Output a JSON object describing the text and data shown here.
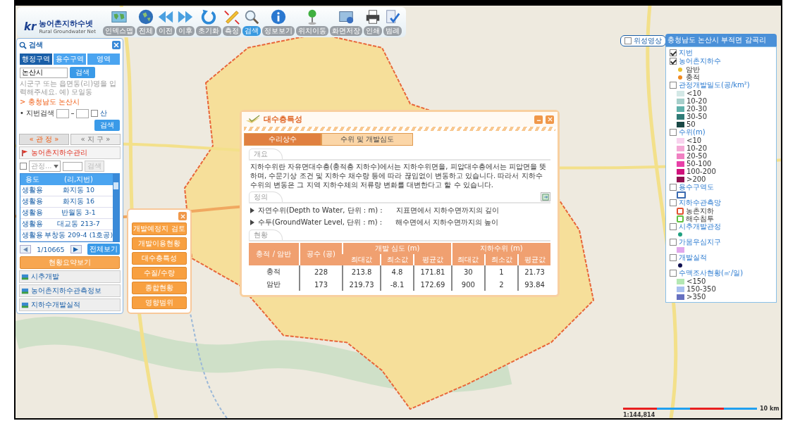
{
  "toolbar": {
    "logo": {
      "mark": "kr",
      "title": "농어촌지하수넷",
      "subtitle": "Rural Groundwater Net"
    },
    "tools": [
      {
        "kind": "index-map",
        "label": "인덱스맵",
        "selected": false
      },
      {
        "kind": "globe",
        "label": "전체",
        "selected": false
      },
      {
        "kind": "back",
        "label": "이전",
        "selected": false
      },
      {
        "kind": "forward",
        "label": "이후",
        "selected": false
      },
      {
        "kind": "reset",
        "label": "초기화",
        "selected": false
      },
      {
        "kind": "measure",
        "label": "측정",
        "selected": false
      },
      {
        "kind": "search",
        "label": "검색",
        "selected": true
      },
      {
        "kind": "info",
        "label": "정보보기",
        "selected": false
      },
      {
        "kind": "pin",
        "label": "위치이동",
        "selected": false
      },
      {
        "kind": "screen",
        "label": "화면저장",
        "selected": false
      },
      {
        "kind": "print",
        "label": "인쇄",
        "selected": false
      },
      {
        "kind": "legend",
        "label": "범례",
        "selected": false
      }
    ]
  },
  "search_panel": {
    "title": "검색",
    "tabs": [
      {
        "label": "행정구역",
        "selected": true
      },
      {
        "label": "용수구역",
        "selected": false
      },
      {
        "label": "영역",
        "selected": false
      }
    ],
    "region_field": {
      "value": "논산시"
    },
    "search_button": "검색",
    "hint": "시군구 또는 읍면동(리)명을 입력해주세요. 예) 모일동",
    "location": "> 충청남도 논산시",
    "lot_search": {
      "label": "• 지번검색",
      "mountain_checked": false,
      "mountain_label": "산",
      "button": "검색"
    },
    "subtabs": [
      {
        "label": "« 관 정 »",
        "selected": true
      },
      {
        "label": "« 지 구 »",
        "selected": false
      }
    ],
    "section": "농어촌지하수관리",
    "filter": {
      "checked": false,
      "select_placeholder": "관정...",
      "button": "검색"
    },
    "table": {
      "columns": [
        "용도",
        "(리,지번)"
      ],
      "rows": [
        [
          "생활용",
          "화지동 10"
        ],
        [
          "생활용",
          "화지동 16"
        ],
        [
          "생활용",
          "반월동 3-1"
        ],
        [
          "생활용",
          "대교동 213-7"
        ],
        [
          "생활용",
          "부창동 209-4 (1호공)"
        ]
      ]
    },
    "pager": {
      "page": "1/10665",
      "all_button": "전체보기"
    },
    "summary_button": "현황요약보기",
    "groups": [
      "시추개발",
      "농어촌지하수관측정보",
      "지하수개발실적"
    ]
  },
  "analysis_menu": {
    "items": [
      "개발예정지 검토",
      "개발이용현황",
      "대수층특성",
      "수질/수량",
      "종합현황",
      "영향범위"
    ]
  },
  "dialog": {
    "title": "대수층특성",
    "tabs": [
      {
        "label": "수리상수",
        "selected": true
      },
      {
        "label": "수위 및 개발심도",
        "selected": false
      }
    ],
    "overview": {
      "heading": "개요",
      "text": "지하수위란 자유면대수층(충적층 지하수)에서는 지하수위면을, 피압대수층에서는 피압면을 뜻하며, 수문기상 조건 및 지하수 채수량 등에 따라 끊임없이 변동하고 있습니다. 따라서 지하수 수위의 변동은 그 지역 지하수체의 저류량 변화를 대변한다고 할 수 있습니다."
    },
    "definitions": {
      "heading": "정의",
      "items": [
        {
          "term": "자연수위(Depth to Water, 단위 : m) :",
          "meaning": "지표면에서 지하수면까지의 깊이"
        },
        {
          "term": "수두(GroundWater Level, 단위 : m) :",
          "meaning": "해수면에서 지하수면까지의 높이"
        }
      ]
    },
    "status": {
      "heading": "현황",
      "columns": {
        "type": "충적 / 암반",
        "count": "공수 (공)",
        "depth": "개발 심도 (m)",
        "level": "지하수위 (m)",
        "depth_sub": [
          "최대값",
          "최소값",
          "평균값"
        ],
        "level_sub": [
          "최대값",
          "최소값",
          "평균값"
        ]
      },
      "rows": [
        [
          "충적",
          "228",
          "213.8",
          "4.8",
          "171.81",
          "30",
          "1",
          "21.73"
        ],
        [
          "암반",
          "173",
          "219.73",
          "-8.1",
          "172.69",
          "900",
          "2",
          "93.84"
        ]
      ]
    }
  },
  "satellite_toggle": {
    "label": "위성영상",
    "checked": false
  },
  "legend": {
    "header": "충청남도 논산시 부적면 감곡리",
    "groups": [
      {
        "label": "지번",
        "checked": true
      },
      {
        "label": "농어촌지하수",
        "checked": true,
        "items": [
          {
            "kind": "dot",
            "label": "암반",
            "color": "#e8c030"
          },
          {
            "kind": "dot",
            "label": "충적",
            "color": "#f08a20"
          }
        ]
      },
      {
        "label": "관정개발밀도(공/km²)",
        "checked": false,
        "items": [
          {
            "kind": "swatch",
            "label": "<10",
            "color": "#d3e8e6"
          },
          {
            "kind": "swatch",
            "label": "10-20",
            "color": "#a6cfcb"
          },
          {
            "kind": "swatch",
            "label": "20-30",
            "color": "#5fb0aa"
          },
          {
            "kind": "swatch",
            "label": "30-50",
            "color": "#2f7a76"
          },
          {
            "kind": "swatch",
            "label": "50",
            "color": "#1a4846"
          }
        ]
      },
      {
        "label": "수위(m)",
        "checked": false,
        "items": [
          {
            "kind": "swatch",
            "label": "<10",
            "color": "#f8d2ee"
          },
          {
            "kind": "swatch",
            "label": "10-20",
            "color": "#f4a9d6"
          },
          {
            "kind": "swatch",
            "label": "20-50",
            "color": "#f080c2"
          },
          {
            "kind": "swatch",
            "label": "50-100",
            "color": "#e840a8"
          },
          {
            "kind": "swatch",
            "label": "100-200",
            "color": "#d0127c"
          },
          {
            "kind": "swatch",
            "label": ">200",
            "color": "#901050"
          }
        ]
      },
      {
        "label": "용수구역도",
        "checked": false,
        "items": [
          {
            "kind": "outline",
            "color": "#3a6ab0"
          }
        ]
      },
      {
        "label": "지하수관측망",
        "checked": false,
        "items": [
          {
            "kind": "marker",
            "label": "농촌지하",
            "color": "#e05030"
          },
          {
            "kind": "marker",
            "label": "해수침투",
            "color": "#60c040"
          }
        ]
      },
      {
        "label": "시추개발관정",
        "checked": false,
        "items": [
          {
            "kind": "dot",
            "color": "#20a080"
          }
        ]
      },
      {
        "label": "가뭄우심지구",
        "checked": false,
        "items": [
          {
            "kind": "swatch",
            "color": "#e0a8ec"
          }
        ]
      },
      {
        "label": "개발실적",
        "checked": false,
        "items": [
          {
            "kind": "dot",
            "color": "#101050"
          }
        ]
      },
      {
        "label": "수맥조사현황(㎥/일)",
        "checked": false,
        "items": [
          {
            "kind": "swatch",
            "label": "<150",
            "color": "#b4e8b4"
          },
          {
            "kind": "swatch",
            "label": "150-350",
            "color": "#a8c0f0"
          },
          {
            "kind": "swatch",
            "label": ">350",
            "color": "#6670c0"
          }
        ]
      }
    ]
  },
  "scale_bar": {
    "ratio": "1:144,814",
    "distance": "10 km"
  }
}
